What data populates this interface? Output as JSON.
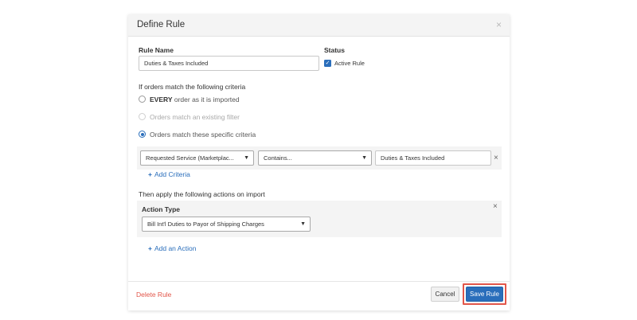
{
  "modal": {
    "title": "Define Rule",
    "close_glyph": "×",
    "close_icon": "close-icon"
  },
  "rule_name": {
    "label": "Rule Name",
    "value": "Duties & Taxes Included"
  },
  "status": {
    "label": "Status",
    "checkbox_label": "Active Rule",
    "checked": true
  },
  "criteria": {
    "heading": "If orders match the following criteria",
    "options": [
      {
        "bold": "EVERY",
        "label": " order as it is imported",
        "state": "unchecked"
      },
      {
        "bold": "",
        "label": "Orders match an existing filter",
        "state": "disabled"
      },
      {
        "bold": "",
        "label": "Orders match these specific criteria",
        "state": "checked"
      }
    ],
    "row": {
      "field_select": "Requested Service (Marketplac...",
      "operator_select": "Contains...",
      "value": "Duties & Taxes Included"
    },
    "add_link": "Add Criteria"
  },
  "actions": {
    "heading": "Then apply the following actions on import",
    "action_type_label": "Action Type",
    "action_select": "Bill Int'l Duties to Payor of Shipping Charges",
    "add_link": "Add an Action"
  },
  "footer": {
    "delete_label": "Delete Rule",
    "cancel_label": "Cancel",
    "save_label": "Save Rule"
  },
  "colors": {
    "accent": "#2a6ebb",
    "danger": "#e2564a",
    "highlight": "#e2564a"
  }
}
